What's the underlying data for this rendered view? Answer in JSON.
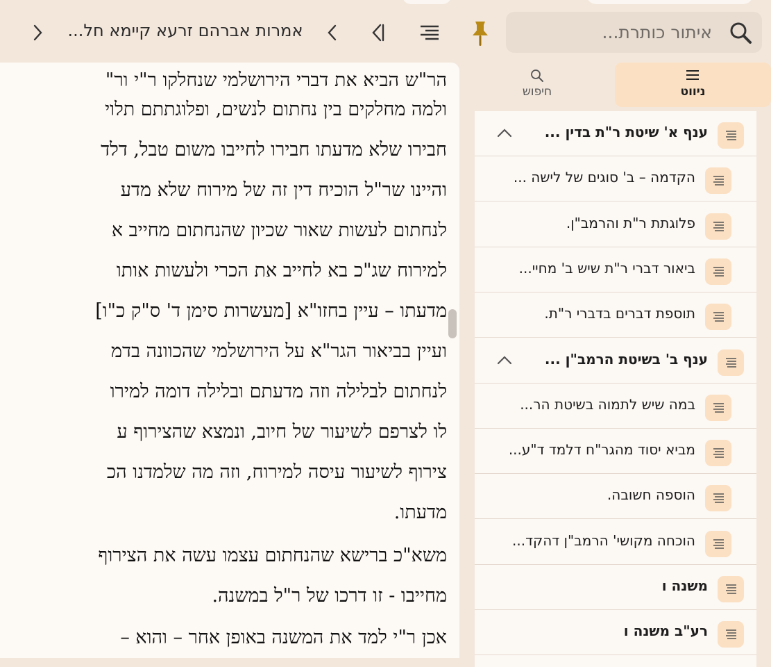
{
  "search": {
    "placeholder": "איתור כותרת..."
  },
  "book": {
    "title": "אמרות אברהם זרעא קיימא חל..."
  },
  "tabs": {
    "navigation": "ניווט",
    "search": "חיפוש"
  },
  "content": {
    "lines": [
      "הר\"ש הביא את דברי הירושלמי שנחלקו ר\"י ור\"",
      "ולמה מחלקים בין נחתום לנשים, ופלוגתתם תלוי",
      "חבירו שלא מדעתו חבירו לחייבו משום טבל, דלד",
      "והיינו שר\"ל הוכיח דין זה של מירוח שלא מדע",
      "לנחתום לעשות שאור שכיון שהנחתום מחייב א",
      "למירוח שג\"כ בא לחייב את הכרי ולעשות אותו",
      "מדעתו – עיין בחזו\"א [מעשרות סימן ד' ס\"ק כ\"ו]",
      "ועיין בביאור הגר\"א על הירושלמי שהכוונה בדמ",
      "לנחתום לבלילה וזה מדעתם ובלילה דומה למירו",
      "לו לצרפם לשיעור של חיוב, ונמצא שהצירוף ע",
      "צירוף לשיעור עיסה למירוח, וזה מה שלמדנו הכ",
      "מדעתו.",
      "משא\"כ ברישא שהנחתום עצמו עשה את הצירוף",
      "מחייבו - זו דרכו של ר\"ל במשנה.",
      "אכן ר\"י למד את המשנה באופן אחר – והוא –"
    ]
  },
  "toc": [
    {
      "label": "ענף א' שיטת ר\"ת בדין ...",
      "level": 1,
      "expanded": true
    },
    {
      "label": "הקדמה – ב' סוגים של לישה ...",
      "level": 2
    },
    {
      "label": "פלוגתת ר\"ת והרמב\"ן.",
      "level": 2
    },
    {
      "label": "ביאור דברי ר\"ת שיש ב' מחיי...",
      "level": 2
    },
    {
      "label": "תוספת דברים בדברי ר\"ת.",
      "level": 2
    },
    {
      "label": "ענף ב' בשיטת הרמב\"ן ...",
      "level": 1,
      "expanded": true
    },
    {
      "label": "במה שיש לתמוה בשיטת הר...",
      "level": 2
    },
    {
      "label": "מביא יסוד מהגר\"ח דלמד ד\"ע...",
      "level": 2
    },
    {
      "label": "הוספה חשובה.",
      "level": 2
    },
    {
      "label": "הוכחה מקושי' הרמב\"ן דהקד...",
      "level": 2
    },
    {
      "label": "משנה ו",
      "level": 1
    },
    {
      "label": "רע\"ב משנה ו",
      "level": 1
    }
  ],
  "colors": {
    "accent": "#fbe0c3",
    "background": "#f3e7dc",
    "page": "#fdf9f5"
  }
}
